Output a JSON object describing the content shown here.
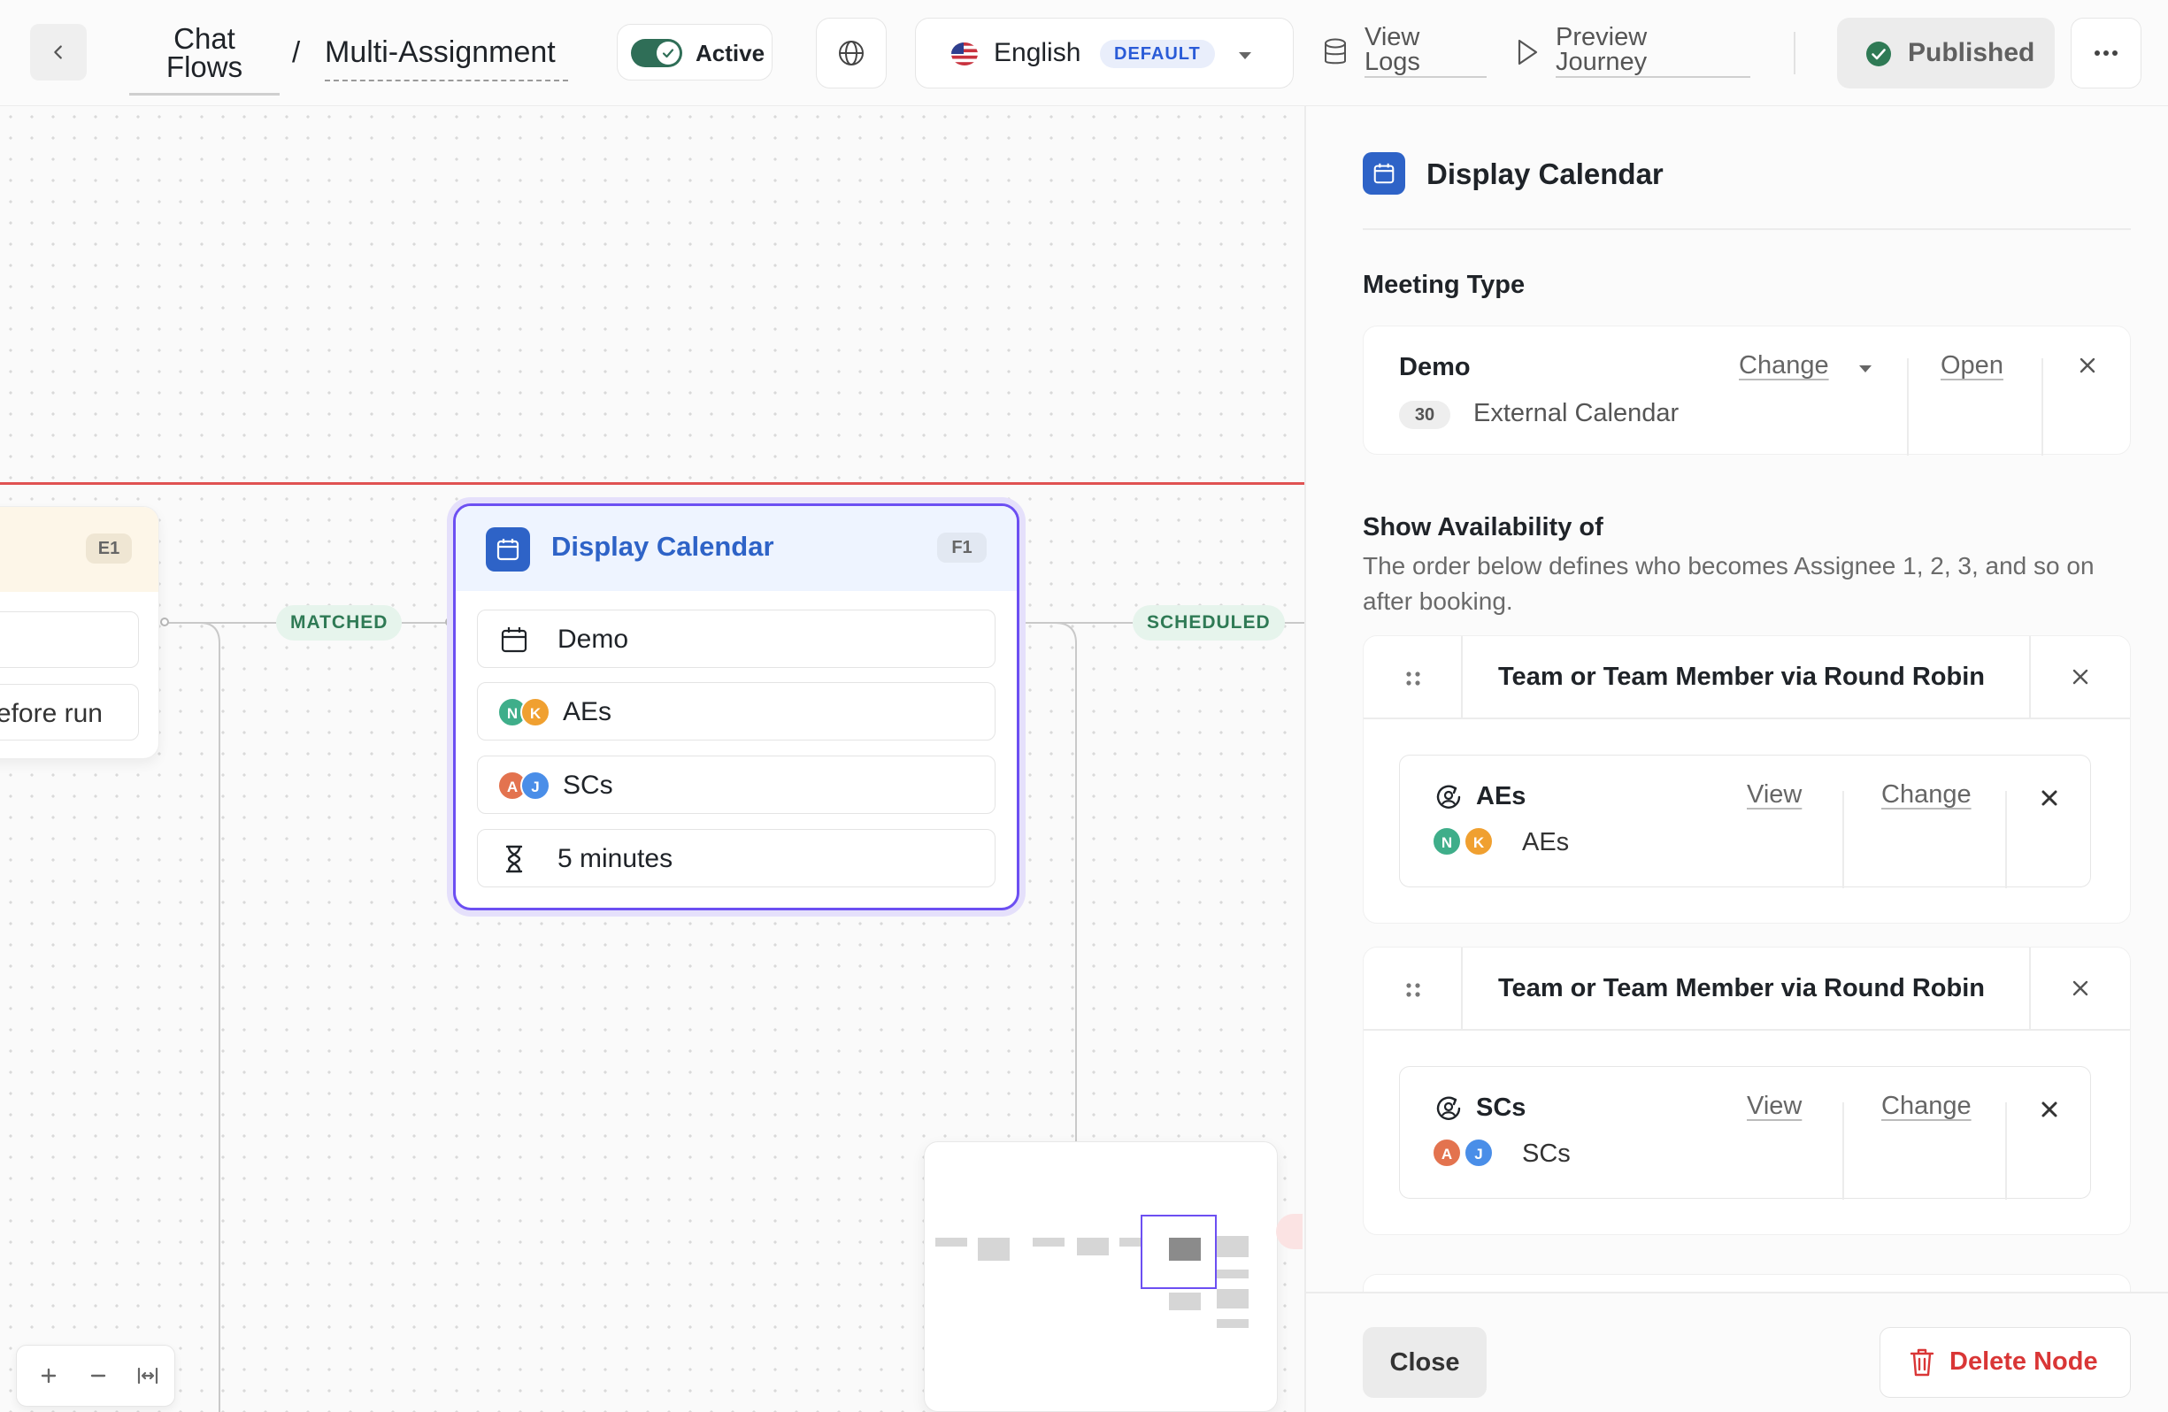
{
  "topbar": {
    "breadcrumb_root": "Chat\nFlows",
    "breadcrumb_separator": "/",
    "breadcrumb_current": "Multi-Assignment",
    "active_label": "Active",
    "active_on": true,
    "language": "English",
    "language_badge": "DEFAULT",
    "view_logs": "View\nLogs",
    "preview_journey": "Preview\nJourney",
    "published_label": "Published"
  },
  "canvas": {
    "node_e1": {
      "badge": "E1",
      "row2_text": "Before run"
    },
    "edges": {
      "matched": "MATCHED",
      "scheduled": "SCHEDULED"
    },
    "node_f1": {
      "title": "Display Calendar",
      "badge": "F1",
      "rows": [
        {
          "label": "Demo",
          "icon": "calendar-icon"
        },
        {
          "label": "AEs",
          "avatars": [
            "N",
            "K"
          ]
        },
        {
          "label": "SCs",
          "avatars": [
            "A",
            "J"
          ]
        },
        {
          "label": "5 minutes",
          "icon": "hourglass-icon"
        }
      ]
    }
  },
  "panel": {
    "title": "Display Calendar",
    "meeting_type_label": "Meeting Type",
    "meeting_type": {
      "name": "Demo",
      "duration": "30",
      "source": "External Calendar",
      "change": "Change",
      "open": "Open"
    },
    "availability_label": "Show Availability of",
    "availability_hint": "The order below defines who becomes Assignee 1, 2, 3, and so on after booking.",
    "groups": [
      {
        "title": "Team or Team Member via Round Robin",
        "team_name": "AEs",
        "team_sub": "AEs",
        "avatars": [
          "N",
          "K"
        ],
        "view": "View",
        "change": "Change"
      },
      {
        "title": "Team or Team Member via Round Robin",
        "team_name": "SCs",
        "team_sub": "SCs",
        "avatars": [
          "A",
          "J"
        ],
        "view": "View",
        "change": "Change"
      }
    ],
    "close_label": "Close",
    "delete_label": "Delete Node"
  },
  "colors": {
    "accent_purple": "#6c4ff2",
    "calendar_blue": "#2e63c7",
    "active_green": "#2f6e57",
    "danger_red": "#d93636",
    "avatar_n": "#3fae8a",
    "avatar_k": "#f0a030",
    "avatar_a": "#e3734f",
    "avatar_j": "#4a8ee8"
  }
}
